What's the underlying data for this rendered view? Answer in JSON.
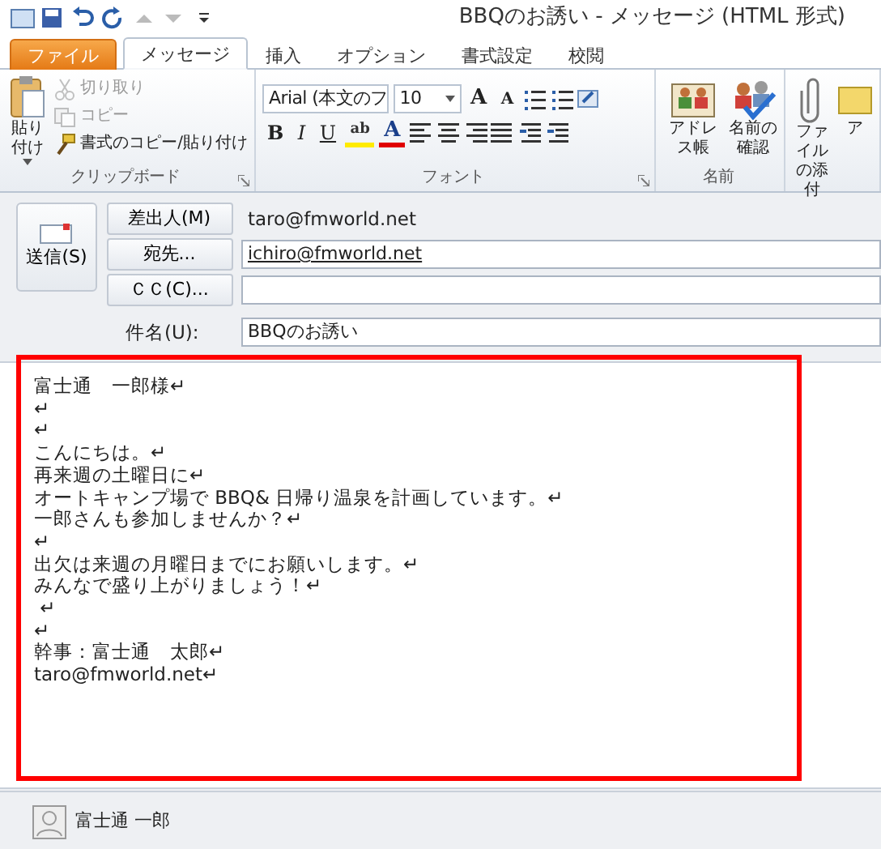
{
  "window": {
    "title": "BBQのお誘い - メッセージ (HTML 形式)"
  },
  "tabs": [
    {
      "label": "ファイル",
      "kind": "file",
      "selected": false
    },
    {
      "label": "メッセージ",
      "kind": "tab",
      "selected": true
    },
    {
      "label": "挿入",
      "kind": "tab",
      "selected": false
    },
    {
      "label": "オプション",
      "kind": "tab",
      "selected": false
    },
    {
      "label": "書式設定",
      "kind": "tab",
      "selected": false
    },
    {
      "label": "校閲",
      "kind": "tab",
      "selected": false
    }
  ],
  "ribbon": {
    "groups": [
      {
        "label": "クリップボード",
        "launcher": true,
        "items": [
          {
            "kind": "paste",
            "label": "貼り付け"
          },
          {
            "kind": "cut",
            "label": "切り取り",
            "disabled": true
          },
          {
            "kind": "copy",
            "label": "コピー",
            "disabled": true
          },
          {
            "kind": "format-painter",
            "label": "書式のコピー/貼り付け",
            "disabled": false
          }
        ]
      },
      {
        "label": "フォント",
        "launcher": true,
        "items": [
          {
            "kind": "font-name",
            "value": "Arial (本文のフ"
          },
          {
            "kind": "font-size",
            "value": "10"
          },
          {
            "kind": "grow",
            "label": "A"
          },
          {
            "kind": "shrink",
            "label": "A"
          },
          {
            "kind": "bullets"
          },
          {
            "kind": "numbering"
          },
          {
            "kind": "styles"
          },
          {
            "kind": "bold",
            "label": "B"
          },
          {
            "kind": "italic",
            "label": "I"
          },
          {
            "kind": "underline",
            "label": "U"
          },
          {
            "kind": "highlight",
            "label": "ab"
          },
          {
            "kind": "font-color",
            "label": "A"
          },
          {
            "kind": "align-left"
          },
          {
            "kind": "align-center"
          },
          {
            "kind": "align-right"
          },
          {
            "kind": "justify"
          },
          {
            "kind": "outdent"
          },
          {
            "kind": "indent"
          }
        ]
      },
      {
        "label": "名前",
        "launcher": false,
        "items": [
          {
            "kind": "address-book",
            "label": "アドレス帳"
          },
          {
            "kind": "check-names",
            "label": "名前の確認"
          }
        ]
      },
      {
        "launcher": false,
        "items": [
          {
            "kind": "attach",
            "label": "ファイルの添付"
          },
          {
            "kind": "item",
            "label": "ア"
          }
        ]
      }
    ]
  },
  "send": {
    "label": "送信(S)"
  },
  "fields": [
    {
      "kind": "from",
      "button": "差出人(M)",
      "value": "taro@fmworld.net"
    },
    {
      "kind": "to",
      "button": "宛先...",
      "value": "ichiro@fmworld.net",
      "resolved": true
    },
    {
      "kind": "cc",
      "button": "ＣＣ(C)..."
    },
    {
      "kind": "subject",
      "label": "件名(U):",
      "value": "BBQのお誘い"
    }
  ],
  "body": {
    "lines": [
      "富士通　一郎様↵",
      "↵",
      "↵",
      "こんにちは。↵",
      "再来週の土曜日に↵",
      "オートキャンプ場で BBQ& 日帰り温泉を計画しています。↵",
      "一郎さんも参加しませんか？↵",
      "↵",
      "出欠は来週の月曜日までにお願いします。↵",
      "みんなで盛り上がりましょう！↵",
      " ↵",
      "↵",
      "幹事：富士通　太郎↵",
      "taro@fmworld.net↵"
    ]
  },
  "people_pane": {
    "name": "富士通 一郎"
  }
}
